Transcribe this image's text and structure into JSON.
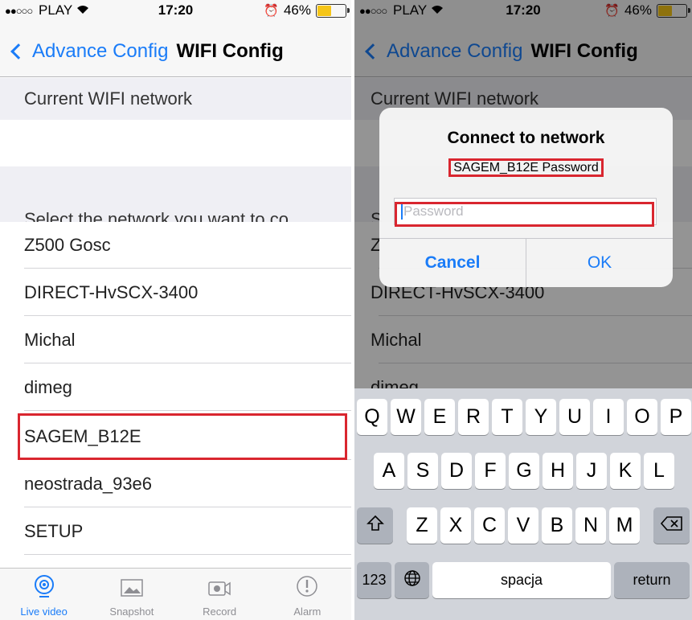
{
  "status_bar": {
    "carrier": "PLAY",
    "signal_dots": "●●○○○",
    "time": "17:20",
    "battery": "46%",
    "battery_level": 0.46
  },
  "nav": {
    "back_label": "Advance Config",
    "title": "WIFI Config"
  },
  "left": {
    "current_header": "Current WIFI network",
    "select_header": "Select the network you want to co...",
    "networks": [
      "Z500 Gosc",
      "DIRECT-HvSCX-3400",
      "Michal",
      "dimeg",
      "SAGEM_B12E",
      "neostrada_93e6",
      "SETUP"
    ],
    "tabs": [
      {
        "label": "Live video",
        "icon": "live-video-icon",
        "active": true
      },
      {
        "label": "Snapshot",
        "icon": "snapshot-icon",
        "active": false
      },
      {
        "label": "Record",
        "icon": "record-icon",
        "active": false
      },
      {
        "label": "Alarm",
        "icon": "alarm-icon",
        "active": false
      }
    ]
  },
  "right": {
    "current_header": "Current WIFI network",
    "partial_rows": [
      "S",
      "Z",
      "DIRECT-HvSCX-3400",
      "Michal",
      "dimeg"
    ],
    "alert": {
      "title": "Connect to network",
      "message": "SAGEM_B12E Password",
      "placeholder": "Password",
      "cancel": "Cancel",
      "ok": "OK"
    },
    "keyboard": {
      "row1": [
        "Q",
        "W",
        "E",
        "R",
        "T",
        "Y",
        "U",
        "I",
        "O",
        "P"
      ],
      "row2": [
        "A",
        "S",
        "D",
        "F",
        "G",
        "H",
        "J",
        "K",
        "L"
      ],
      "row3": [
        "Z",
        "X",
        "C",
        "V",
        "B",
        "N",
        "M"
      ],
      "numbers_key": "123",
      "space_key": "spacja",
      "return_key": "return",
      "shift_icon": "shift-icon",
      "delete_icon": "backspace-icon",
      "globe_icon": "globe-icon"
    }
  },
  "colors": {
    "accent": "#1a7cf8",
    "highlight": "#d9262f",
    "battery_fill": "#f5c518"
  }
}
